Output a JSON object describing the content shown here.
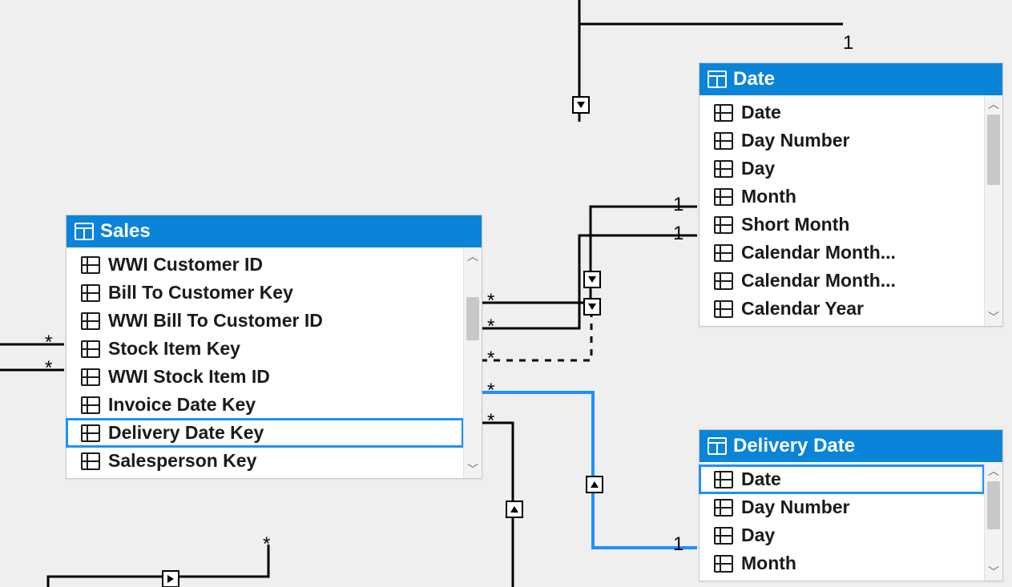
{
  "colors": {
    "accent": "#0a84d9",
    "highlight": "#1e90ff"
  },
  "entities": {
    "sales": {
      "title": "Sales",
      "fields": [
        "WWI Customer ID",
        "Bill To Customer Key",
        "WWI Bill To Customer ID",
        "Stock Item Key",
        "WWI Stock Item ID",
        "Invoice Date Key",
        "Delivery Date Key",
        "Salesperson Key"
      ],
      "highlight_index": 6
    },
    "date": {
      "title": "Date",
      "fields": [
        "Date",
        "Day Number",
        "Day",
        "Month",
        "Short Month",
        "Calendar Month...",
        "Calendar Month...",
        "Calendar Year"
      ],
      "highlight_index": -1
    },
    "delivery_date": {
      "title": "Delivery Date",
      "fields": [
        "Date",
        "Day Number",
        "Day",
        "Month"
      ],
      "highlight_index": 0
    }
  },
  "cardinality": {
    "star": "*",
    "one": "1"
  },
  "relationships": [
    {
      "from": "Sales.Invoice Date Key",
      "to": "Date.Date",
      "kind": "many-to-one",
      "style": "solid"
    },
    {
      "from": "Sales",
      "to": "Date",
      "kind": "many-to-one",
      "style": "solid"
    },
    {
      "from": "Sales",
      "to": "Date",
      "kind": "many-to-one",
      "style": "dashed"
    },
    {
      "from": "Sales.Delivery Date Key",
      "to": "Delivery Date.Date",
      "kind": "many-to-one",
      "style": "solid-highlighted"
    },
    {
      "from": "Sales",
      "to": "(off-canvas left)",
      "kind": "many",
      "style": "solid"
    },
    {
      "from": "Sales",
      "to": "(off-canvas bottom)",
      "kind": "many",
      "style": "solid"
    }
  ]
}
